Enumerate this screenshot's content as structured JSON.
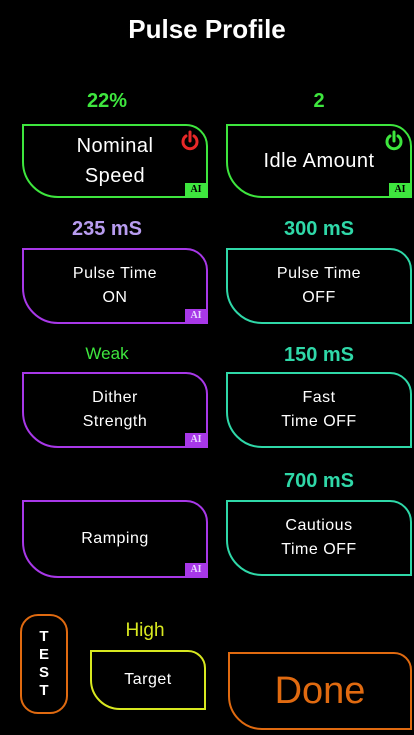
{
  "title": "Pulse Profile",
  "colors": {
    "green": "#3ee63e",
    "purple": "#a838e8",
    "teal": "#2fd8a8",
    "yellow": "#d8e820",
    "orange": "#e06a10",
    "red": "#e82828",
    "lavender": "#b89cf0"
  },
  "nominal_speed": {
    "value": "22%",
    "label": "Nominal\nSpeed",
    "ai": "AI"
  },
  "idle_amount": {
    "value": "2",
    "label": "Idle Amount",
    "ai": "AI"
  },
  "pulse_on": {
    "value": "235 mS",
    "label": "Pulse Time\nON",
    "ai": "AI"
  },
  "pulse_off": {
    "value": "300 mS",
    "label": "Pulse Time\nOFF"
  },
  "dither": {
    "value": "Weak",
    "label": "Dither\nStrength",
    "ai": "AI"
  },
  "fast_off": {
    "value": "150 mS",
    "label": "Fast\nTime OFF"
  },
  "cautious_off": {
    "value": "700 mS",
    "label": "Cautious\nTime OFF"
  },
  "ramping": {
    "label": "Ramping",
    "ai": "AI"
  },
  "target": {
    "value": "High",
    "label": "Target"
  },
  "test": {
    "letters": [
      "T",
      "E",
      "S",
      "T"
    ]
  },
  "done": {
    "label": "Done"
  },
  "icons": {
    "power_on": "power-icon",
    "power_off": "power-icon"
  }
}
